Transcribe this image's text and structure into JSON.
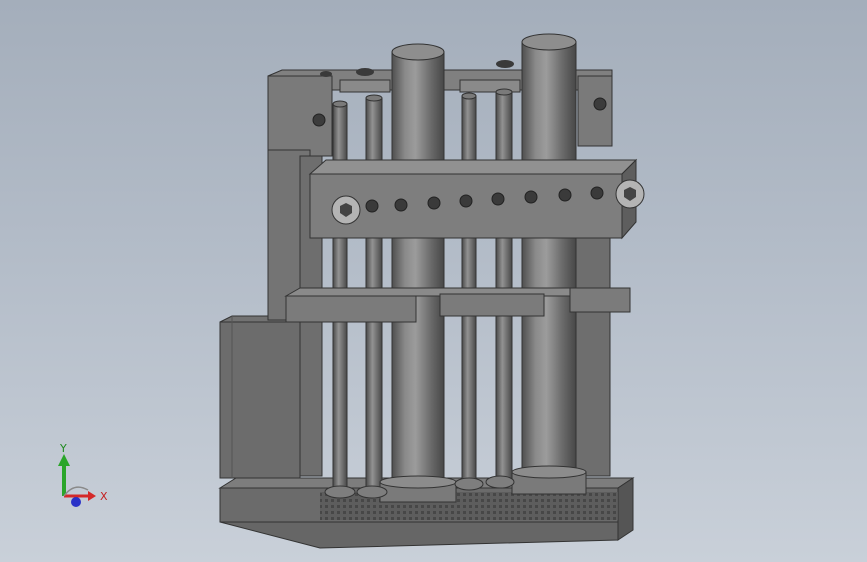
{
  "viewport": {
    "background_top": "#a4aebb",
    "background_bottom": "#c9d0d9"
  },
  "model": {
    "body_color": "#707070",
    "shadow_color": "#4a4a4a"
  },
  "triad": {
    "x_label": "X",
    "y_label": "Y",
    "x_color": "#d42a2a",
    "y_color": "#2aa52a",
    "z_color": "#2a32c8"
  }
}
